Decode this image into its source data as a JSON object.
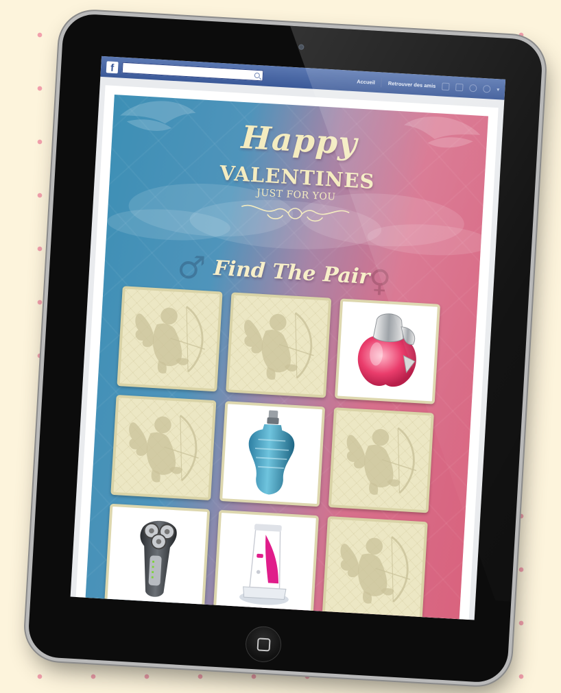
{
  "facebook_bar": {
    "logo": "f",
    "search_value": "",
    "nav": [
      "Accueil",
      "Retrouver des amis"
    ],
    "icons": [
      "friend-requests-icon",
      "messages-icon",
      "notifications-icon",
      "account-icon"
    ]
  },
  "game": {
    "title_line1": "Happy",
    "title_line2": "VALENTINES",
    "title_line3": "JUST FOR YOU",
    "headline": "Find The Pair",
    "male_symbol": "♂",
    "female_symbol": "♀",
    "cards": [
      {
        "state": "hidden",
        "icon": "cupid-icon"
      },
      {
        "state": "hidden",
        "icon": "cupid-icon"
      },
      {
        "state": "revealed",
        "icon": "perfume-apple-icon"
      },
      {
        "state": "hidden",
        "icon": "cupid-icon"
      },
      {
        "state": "revealed",
        "icon": "perfume-torso-icon"
      },
      {
        "state": "hidden",
        "icon": "cupid-icon"
      },
      {
        "state": "revealed",
        "icon": "electric-shaver-icon"
      },
      {
        "state": "revealed",
        "icon": "epilator-icon"
      },
      {
        "state": "hidden",
        "icon": "cupid-icon"
      }
    ]
  },
  "colors": {
    "background": "#fdf4dc",
    "dots": "#f2a0ac",
    "facebook_blue": "#3b5998",
    "game_blue": "#3d8fb5",
    "game_pink": "#d9637e",
    "title_cream": "#f4ecc0",
    "card_back": "#ece7c4"
  }
}
